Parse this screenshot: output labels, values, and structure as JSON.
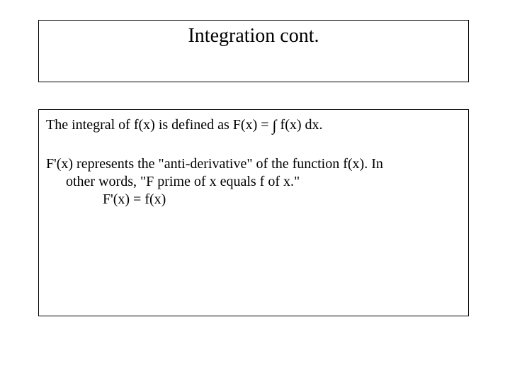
{
  "title": "Integration cont.",
  "body": {
    "line1_prefix": "The integral of f(x) is defined as F(x) = ",
    "integral_symbol": "∫",
    "line1_suffix": " f(x) dx.",
    "line2": "F'(x) represents the \"anti-derivative\" of the function f(x). In",
    "line3": "other words, \"F prime of x equals f of x.\"",
    "line4": "F'(x) = f(x)"
  }
}
